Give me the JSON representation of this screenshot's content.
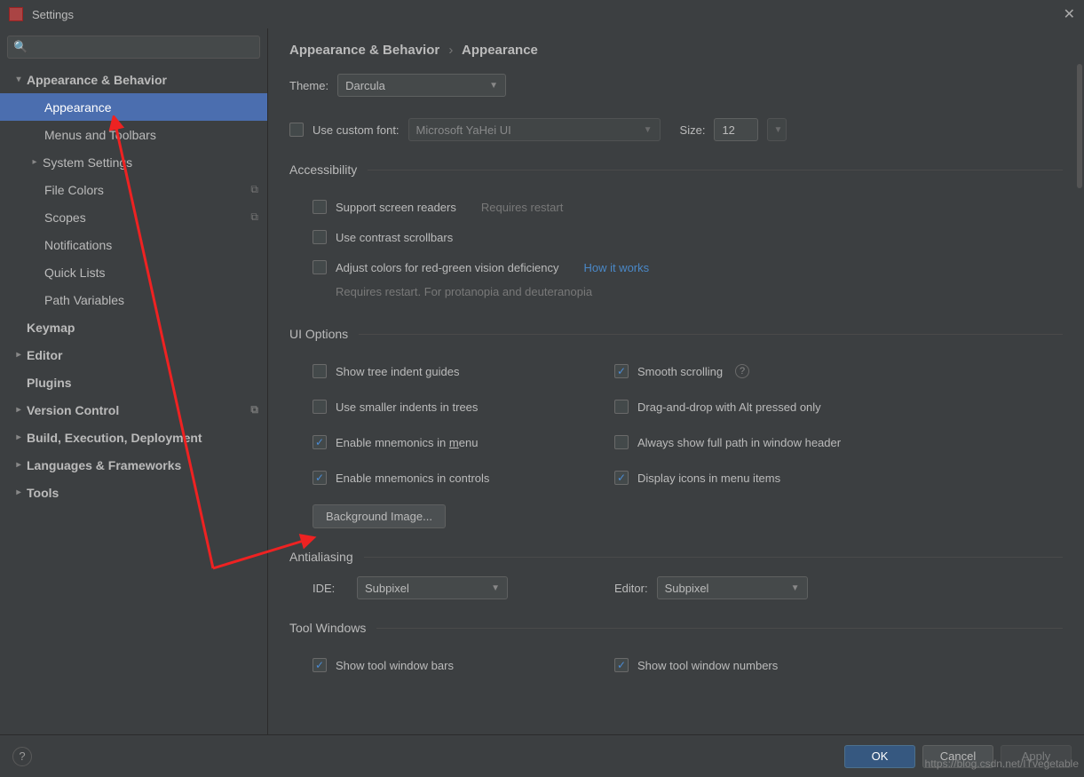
{
  "title": "Settings",
  "breadcrumb": {
    "parent": "Appearance & Behavior",
    "current": "Appearance"
  },
  "sidebar": {
    "items": [
      {
        "label": "Appearance & Behavior",
        "level": 0,
        "bold": true,
        "chev": "open"
      },
      {
        "label": "Appearance",
        "level": 2,
        "selected": true
      },
      {
        "label": "Menus and Toolbars",
        "level": 2
      },
      {
        "label": "System Settings",
        "level": 1,
        "chev": "closed"
      },
      {
        "label": "File Colors",
        "level": 2,
        "trail": "copy"
      },
      {
        "label": "Scopes",
        "level": 2,
        "trail": "copy"
      },
      {
        "label": "Notifications",
        "level": 2
      },
      {
        "label": "Quick Lists",
        "level": 2
      },
      {
        "label": "Path Variables",
        "level": 2
      },
      {
        "label": "Keymap",
        "level": 0,
        "bold": true
      },
      {
        "label": "Editor",
        "level": 0,
        "bold": true,
        "chev": "closed"
      },
      {
        "label": "Plugins",
        "level": 0,
        "bold": true
      },
      {
        "label": "Version Control",
        "level": 0,
        "bold": true,
        "chev": "closed",
        "trail": "copy"
      },
      {
        "label": "Build, Execution, Deployment",
        "level": 0,
        "bold": true,
        "chev": "closed"
      },
      {
        "label": "Languages & Frameworks",
        "level": 0,
        "bold": true,
        "chev": "closed"
      },
      {
        "label": "Tools",
        "level": 0,
        "bold": true,
        "chev": "closed"
      }
    ]
  },
  "theme": {
    "label": "Theme:",
    "value": "Darcula"
  },
  "custom_font": {
    "label": "Use custom font:",
    "value": "Microsoft YaHei UI",
    "size_label": "Size:",
    "size_value": "12"
  },
  "accessibility": {
    "legend": "Accessibility",
    "screen_readers": "Support screen readers",
    "screen_readers_hint": "Requires restart",
    "contrast": "Use contrast scrollbars",
    "color_adjust": "Adjust colors for red-green vision deficiency",
    "how_it_works": "How it works",
    "color_adjust_hint": "Requires restart. For protanopia and deuteranopia"
  },
  "ui_options": {
    "legend": "UI Options",
    "tree_indent": "Show tree indent guides",
    "smaller_indents": "Use smaller indents in trees",
    "mnemonics_menu_pre": "Enable mnemonics in ",
    "mnemonics_menu_u": "m",
    "mnemonics_menu_post": "enu",
    "mnemonics_controls": "Enable mnemonics in controls",
    "smooth": "Smooth scrolling",
    "dnd_alt": "Drag-and-drop with Alt pressed only",
    "full_path": "Always show full path in window header",
    "icons_menu": "Display icons in menu items",
    "bg_image": "Background Image..."
  },
  "antialiasing": {
    "legend": "Antialiasing",
    "ide_label": "IDE:",
    "ide_value": "Subpixel",
    "editor_label": "Editor:",
    "editor_value": "Subpixel"
  },
  "tool_windows": {
    "legend": "Tool Windows",
    "bars": "Show tool window bars",
    "numbers": "Show tool window numbers"
  },
  "footer": {
    "ok": "OK",
    "cancel": "Cancel",
    "apply": "Apply"
  },
  "watermark": "https://blog.csdn.net/ITvegetable"
}
